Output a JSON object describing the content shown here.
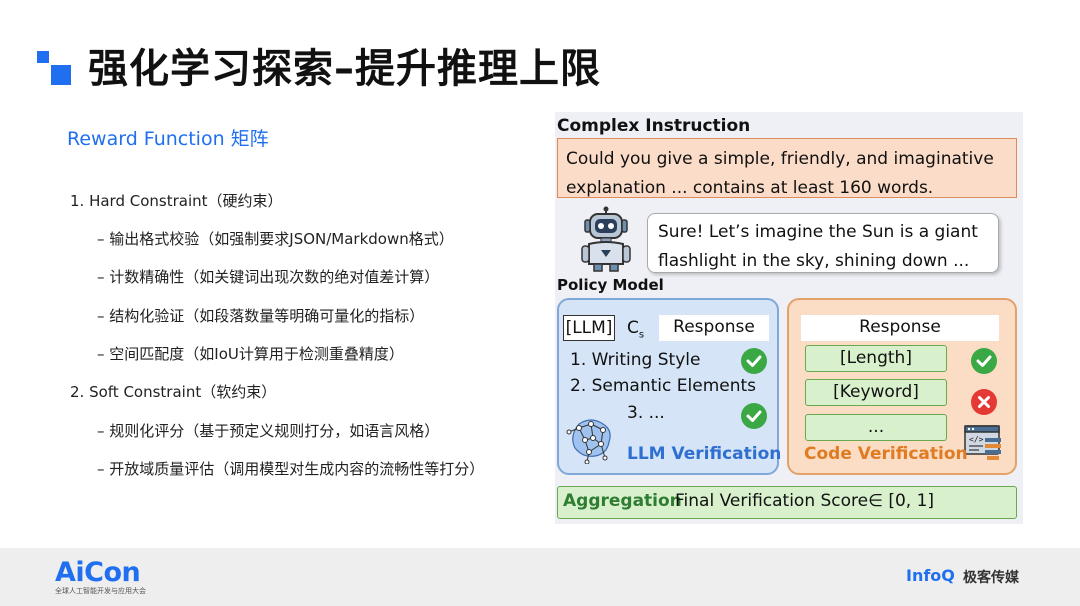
{
  "header": {
    "title": "强化学习探索–提升推理上限",
    "brand_color": "#1f6ff0"
  },
  "content": {
    "subtitle": "Reward Function 矩阵",
    "outline": [
      {
        "level": 1,
        "text": "1. Hard Constraint（硬约束）"
      },
      {
        "level": 2,
        "text": "– 输出格式校验（如强制要求JSON/Markdown格式）"
      },
      {
        "level": 2,
        "text": "– 计数精确性（如关键词出现次数的绝对值差计算）"
      },
      {
        "level": 2,
        "text": "– 结构化验证（如段落数量等明确可量化的指标）"
      },
      {
        "level": 2,
        "text": "– 空间匹配度（如IoU计算用于检测重叠精度）"
      },
      {
        "level": 1,
        "text": "2. Soft Constraint（软约束）"
      },
      {
        "level": 2,
        "text": "– 规则化评分（基于预定义规则打分，如语言风格）"
      },
      {
        "level": 2,
        "text": "– 开放域质量评估（调用模型对生成内容的流畅性等打分）"
      }
    ]
  },
  "diagram": {
    "complex_instruction_label": "Complex Instruction",
    "instruction_text": "Could you give a simple, friendly, and imaginative explanation ... contains at least 160 words.",
    "response_bubble": "Sure! Let’s imagine the Sun is a giant flashlight in the sky, shining down ...",
    "policy_model_label": "Policy Model",
    "llm_chip": "[LLM]",
    "cs_main": "C",
    "cs_sub": "s",
    "response_label_left": "Response",
    "response_label_right": "Response",
    "criteria": [
      "1. Writing Style",
      "2. Semantic Elements",
      "3.  ..."
    ],
    "code_tags": [
      "[Length]",
      "[Keyword]",
      "..."
    ],
    "llm_verification_label": "LLM Verification",
    "code_verification_label": "Code Verification",
    "aggregation_label": "Aggregation",
    "aggregation_text": "Final Verification Score∈ [0, 1]",
    "colors": {
      "llm_title": "#2f6fd0",
      "code_title": "#e07b22",
      "check": "#3aa845",
      "cross": "#e53935"
    }
  },
  "footer": {
    "brand": "AiCon",
    "brand_sub": "全球人工智能开发与应用大会",
    "infoq": "InfoQ",
    "infoq_cn": "极客传媒"
  }
}
